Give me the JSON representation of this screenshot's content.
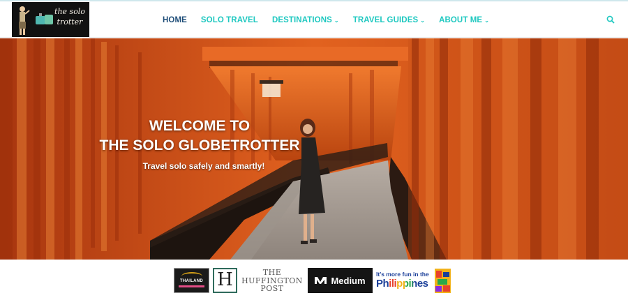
{
  "header": {
    "logo_alt": "the solo trotter",
    "logo_text": "the solo trotter",
    "nav": [
      {
        "label": "HOME",
        "active": true,
        "has_dropdown": false
      },
      {
        "label": "SOLO TRAVEL",
        "active": false,
        "has_dropdown": false
      },
      {
        "label": "DESTINATIONS",
        "active": false,
        "has_dropdown": true
      },
      {
        "label": "TRAVEL GUIDES",
        "active": false,
        "has_dropdown": true
      },
      {
        "label": "ABOUT ME",
        "active": false,
        "has_dropdown": true
      }
    ],
    "search_icon": "search-icon"
  },
  "hero": {
    "title_line1": "WELCOME TO",
    "title_line2": "THE SOLO GLOBETROTTER",
    "subtitle": "Travel solo safely and smartly!"
  },
  "featured": {
    "thailand": "THAILAND",
    "huffington": [
      "THE",
      "HUFFINGTON",
      "POST"
    ],
    "huffington_mark": "H",
    "medium": "Medium",
    "philippines_line1": "It's more fun in the",
    "philippines_line2": "Philippines"
  },
  "colors": {
    "accent": "#1ec8c0",
    "active": "#1f4e79",
    "hero_orange": "#d9541a"
  }
}
